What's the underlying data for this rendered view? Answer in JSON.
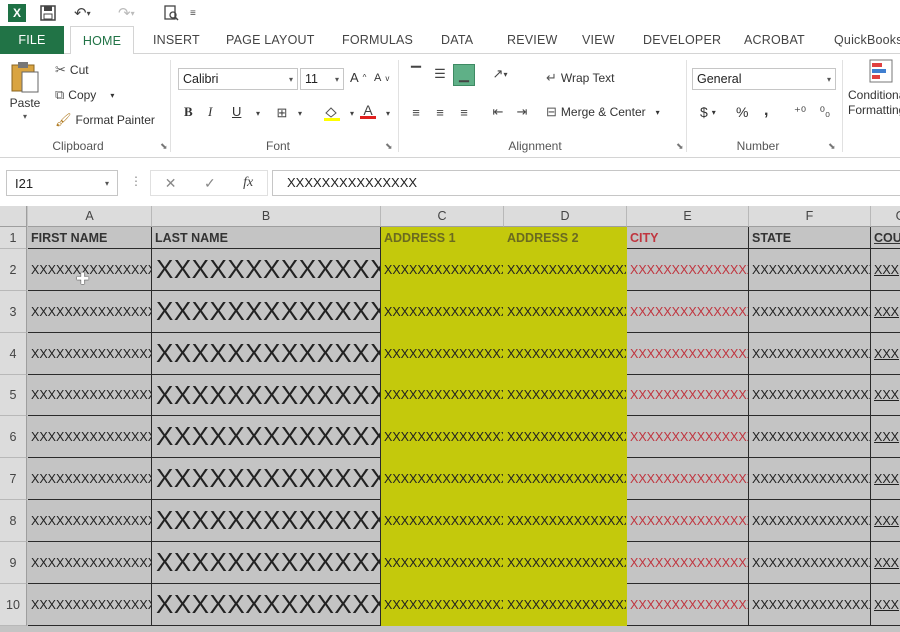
{
  "quick_access": {
    "app_icon": "excel-logo-icon",
    "app_icon_letter": "X",
    "save_icon": "save-icon",
    "undo_icon": "undo-icon",
    "redo_icon": "redo-icon",
    "print_preview_icon": "print-preview-icon",
    "customize_icon": "customize-icon"
  },
  "tabs": [
    {
      "label": "FILE"
    },
    {
      "label": "HOME"
    },
    {
      "label": "INSERT"
    },
    {
      "label": "PAGE LAYOUT"
    },
    {
      "label": "FORMULAS"
    },
    {
      "label": "DATA"
    },
    {
      "label": "REVIEW"
    },
    {
      "label": "VIEW"
    },
    {
      "label": "DEVELOPER"
    },
    {
      "label": "ACROBAT"
    },
    {
      "label": "QuickBooks"
    }
  ],
  "ribbon": {
    "clipboard": {
      "group_label": "Clipboard",
      "paste": "Paste",
      "cut": "Cut",
      "copy": "Copy",
      "format_painter": "Format Painter"
    },
    "font": {
      "group_label": "Font",
      "font_name": "Calibri",
      "font_size": "11",
      "bold": "B",
      "italic": "I",
      "underline": "U",
      "grow": "A",
      "shrink": "A"
    },
    "alignment": {
      "group_label": "Alignment",
      "wrap_text": "Wrap Text",
      "merge_center": "Merge & Center"
    },
    "number": {
      "group_label": "Number",
      "format": "General",
      "currency": "$",
      "percent": "%",
      "comma": ","
    },
    "styles": {
      "conditional_formatting": "Conditional Formatting"
    }
  },
  "formula_bar": {
    "name_box": "I21",
    "fx": "fx",
    "value": "XXXXXXXXXXXXXXX"
  },
  "columns": [
    {
      "letter": "A"
    },
    {
      "letter": "B"
    },
    {
      "letter": "C"
    },
    {
      "letter": "D"
    },
    {
      "letter": "E"
    },
    {
      "letter": "F"
    },
    {
      "letter": "G"
    }
  ],
  "header_row": {
    "number": "1",
    "cells": [
      "FIRST NAME",
      "LAST NAME",
      "ADDRESS 1",
      "ADDRESS 2",
      "CITY",
      "STATE",
      "COU"
    ]
  },
  "rows": [
    {
      "number": "2",
      "cells": [
        "XXXXXXXXXXXXXXX",
        "XXXXXXXXXXXXXX",
        "XXXXXXXXXXXXXXX",
        "XXXXXXXXXXXXXXX",
        "XXXXXXXXXXXXXXX",
        "XXXXXXXXXXXXXXX",
        "XXX"
      ]
    },
    {
      "number": "3",
      "cells": [
        "XXXXXXXXXXXXXXX",
        "XXXXXXXXXXXXXX",
        "XXXXXXXXXXXXXXX",
        "XXXXXXXXXXXXXXX",
        "XXXXXXXXXXXXXXX",
        "XXXXXXXXXXXXXXX",
        "XXX"
      ]
    },
    {
      "number": "4",
      "cells": [
        "XXXXXXXXXXXXXXX",
        "XXXXXXXXXXXXXX",
        "XXXXXXXXXXXXXXX",
        "XXXXXXXXXXXXXXX",
        "XXXXXXXXXXXXXXX",
        "XXXXXXXXXXXXXXX",
        "XXX"
      ]
    },
    {
      "number": "5",
      "cells": [
        "XXXXXXXXXXXXXXX",
        "XXXXXXXXXXXXXX",
        "XXXXXXXXXXXXXXX",
        "XXXXXXXXXXXXXXX",
        "XXXXXXXXXXXXXXX",
        "XXXXXXXXXXXXXXX",
        "XXX"
      ]
    },
    {
      "number": "6",
      "cells": [
        "XXXXXXXXXXXXXXX",
        "XXXXXXXXXXXXXX",
        "XXXXXXXXXXXXXXX",
        "XXXXXXXXXXXXXXX",
        "XXXXXXXXXXXXXXX",
        "XXXXXXXXXXXXXXX",
        "XXX"
      ]
    },
    {
      "number": "7",
      "cells": [
        "XXXXXXXXXXXXXXX",
        "XXXXXXXXXXXXXX",
        "XXXXXXXXXXXXXXX",
        "XXXXXXXXXXXXXXX",
        "XXXXXXXXXXXXXXX",
        "XXXXXXXXXXXXXXX",
        "XXX"
      ]
    },
    {
      "number": "8",
      "cells": [
        "XXXXXXXXXXXXXXX",
        "XXXXXXXXXXXXXX",
        "XXXXXXXXXXXXXXX",
        "XXXXXXXXXXXXXXX",
        "XXXXXXXXXXXXXXX",
        "XXXXXXXXXXXXXXX",
        "XXX"
      ]
    },
    {
      "number": "9",
      "cells": [
        "XXXXXXXXXXXXXXX",
        "XXXXXXXXXXXXXX",
        "XXXXXXXXXXXXXXX",
        "XXXXXXXXXXXXXXX",
        "XXXXXXXXXXXXXXX",
        "XXXXXXXXXXXXXXX",
        "XXX"
      ]
    },
    {
      "number": "10",
      "cells": [
        "XXXXXXXXXXXXXXX",
        "XXXXXXXXXXXXXX",
        "XXXXXXXXXXXXXXX",
        "XXXXXXXXXXXXXXX",
        "XXXXXXXXXXXXXXX",
        "XXXXXXXXXXXXXXX",
        "XXX"
      ]
    }
  ],
  "colors": {
    "excel_green": "#217346",
    "highlight_yellow": "#c4c90c",
    "cell_gray": "#c4c4c4",
    "city_red": "#c0353f"
  }
}
